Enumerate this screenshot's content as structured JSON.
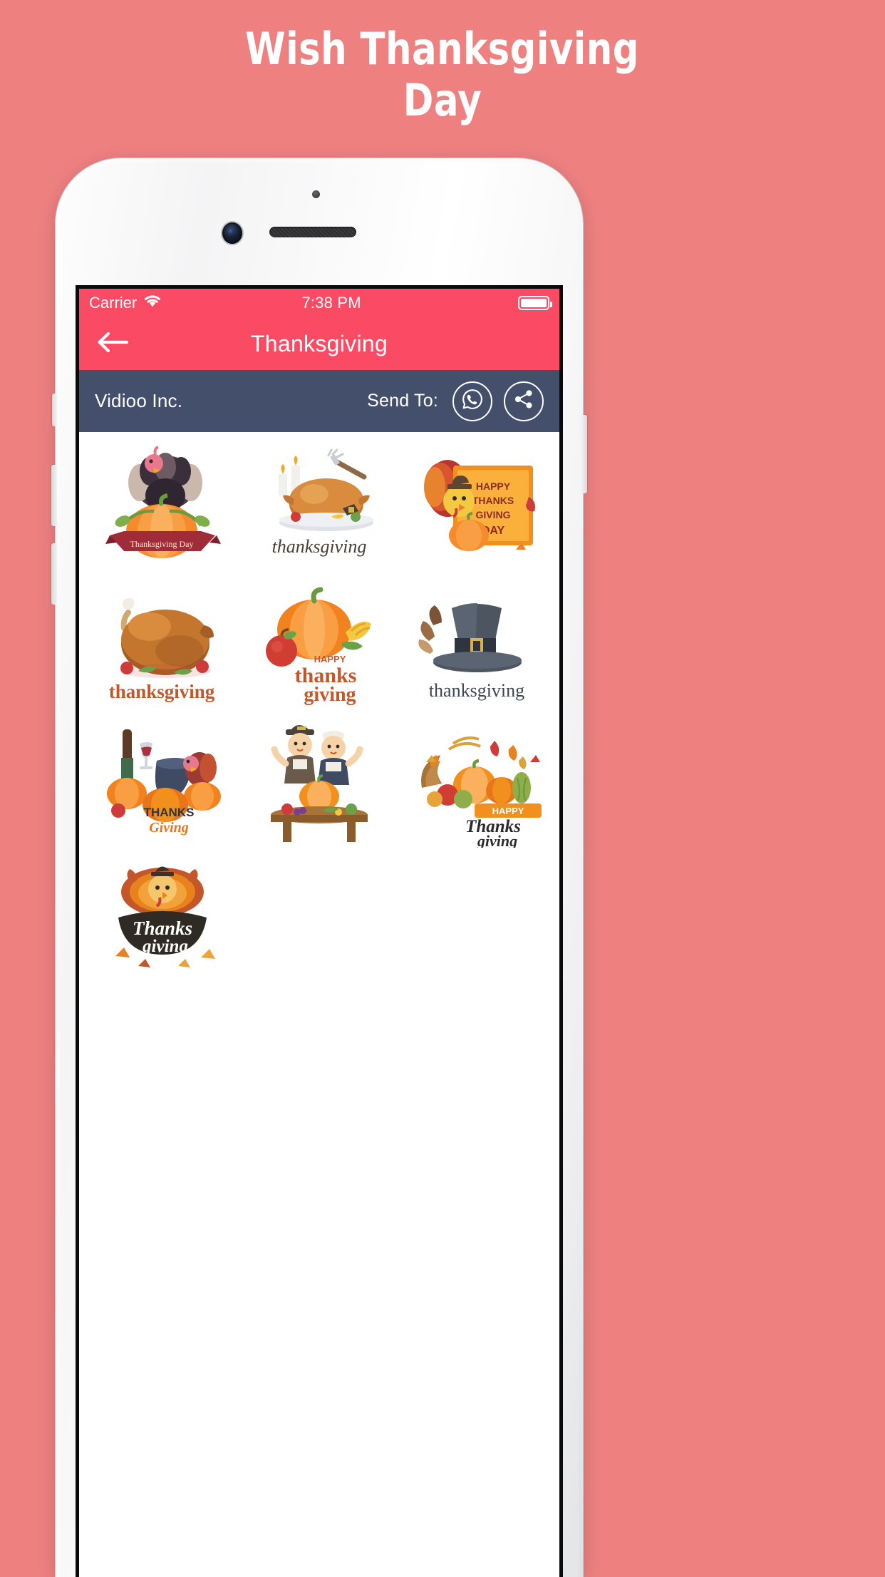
{
  "banner": {
    "line1": "Wish Thanksgiving",
    "line2": "Day"
  },
  "colors": {
    "page_background": "#ee8080",
    "accent_red": "#fb4a63",
    "subbar_navy": "#434f6b",
    "screen_white": "#ffffff",
    "text_white": "#ffffff"
  },
  "phone": {
    "body_color": "#f7f7f8",
    "icons": {
      "sensor": "proximity-sensor-dot",
      "camera": "front-camera",
      "earpiece": "earpiece-speaker-grille",
      "home": "home-button"
    }
  },
  "status_bar": {
    "carrier": "Carrier",
    "wifi_icon": "wifi-icon",
    "time": "7:38 PM",
    "battery_icon": "battery-full-icon"
  },
  "nav_bar": {
    "back_icon": "arrow-left-icon",
    "title": "Thanksgiving"
  },
  "sub_bar": {
    "brand": "Vidioo Inc.",
    "send_to_label": "Send To:",
    "whatsapp_icon": "whatsapp-icon",
    "share_icon": "share-icon"
  },
  "stickers": [
    {
      "id": 1,
      "name": "turkey-pumpkin-banner-sticker",
      "caption": "Thanksgiving Day"
    },
    {
      "id": 2,
      "name": "roast-turkey-platter-sticker",
      "caption": "thanksgiving"
    },
    {
      "id": 3,
      "name": "happy-thanksgiving-day-card-sticker",
      "caption": "HAPPY THANKS GIVING DAY"
    },
    {
      "id": 4,
      "name": "roast-turkey-sticker",
      "caption": "thanksgiving"
    },
    {
      "id": 5,
      "name": "pumpkin-corn-apple-sticker",
      "caption": "HAPPY thanks giving"
    },
    {
      "id": 6,
      "name": "pilgrim-hat-sticker",
      "caption": "thanksgiving"
    },
    {
      "id": 7,
      "name": "pumpkins-wine-turkey-sticker",
      "caption": "THANKS Giving"
    },
    {
      "id": 8,
      "name": "pilgrim-kids-table-sticker",
      "caption": ""
    },
    {
      "id": 9,
      "name": "cornucopia-harvest-sticker",
      "caption": "HAPPY Thanks giving"
    },
    {
      "id": 10,
      "name": "turkey-lettering-sticker",
      "caption": "Thanks giving"
    }
  ]
}
